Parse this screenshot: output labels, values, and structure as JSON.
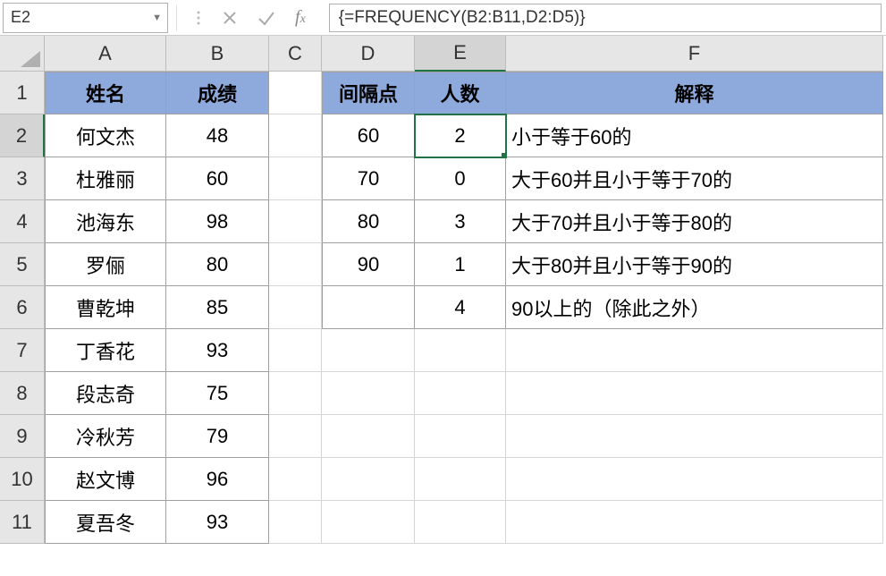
{
  "formula_bar": {
    "cell_ref": "E2",
    "formula": "{=FREQUENCY(B2:B11,D2:D5)}"
  },
  "column_headers": [
    "A",
    "B",
    "C",
    "D",
    "E",
    "F"
  ],
  "row_headers": [
    "1",
    "2",
    "3",
    "4",
    "5",
    "6",
    "7",
    "8",
    "9",
    "10",
    "11"
  ],
  "selected_col_index": 4,
  "selected_row_index": 1,
  "table_headers": {
    "name": "姓名",
    "score": "成绩",
    "interval": "间隔点",
    "count": "人数",
    "explain": "解释"
  },
  "students": [
    {
      "name": "何文杰",
      "score": "48"
    },
    {
      "name": "杜雅丽",
      "score": "60"
    },
    {
      "name": "池海东",
      "score": "98"
    },
    {
      "name": "罗俪",
      "score": "80"
    },
    {
      "name": "曹乾坤",
      "score": "85"
    },
    {
      "name": "丁香花",
      "score": "93"
    },
    {
      "name": "段志奇",
      "score": "75"
    },
    {
      "name": "冷秋芳",
      "score": "79"
    },
    {
      "name": "赵文博",
      "score": "96"
    },
    {
      "name": "夏吾冬",
      "score": "93"
    }
  ],
  "freq": [
    {
      "interval": "60",
      "count": "2",
      "explain": "小于等于60的"
    },
    {
      "interval": "70",
      "count": "0",
      "explain": "大于60并且小于等于70的"
    },
    {
      "interval": "80",
      "count": "3",
      "explain": "大于70并且小于等于80的"
    },
    {
      "interval": "90",
      "count": "1",
      "explain": "大于80并且小于等于90的"
    },
    {
      "interval": "",
      "count": "4",
      "explain": "90以上的（除此之外）"
    }
  ]
}
